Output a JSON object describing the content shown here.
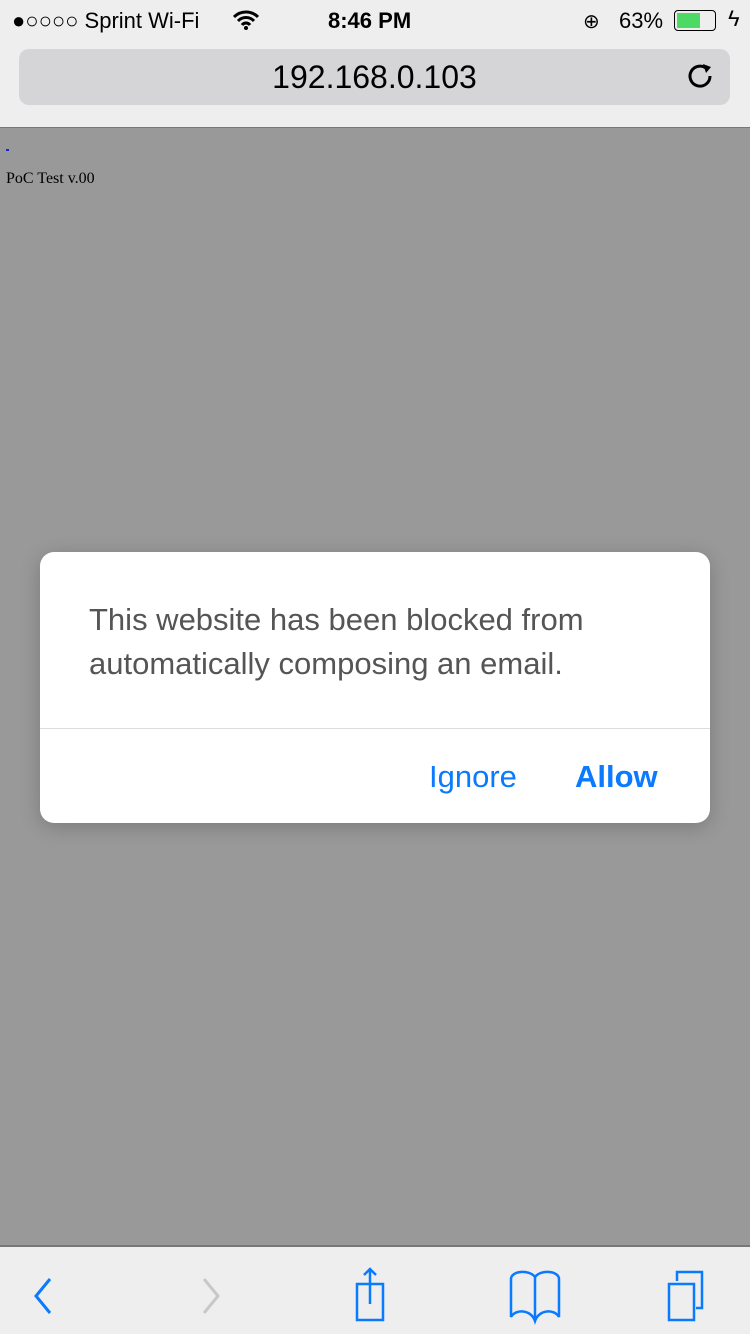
{
  "status_bar": {
    "carrier": "●○○○○ Sprint Wi-Fi",
    "time": "8:46 PM",
    "battery": "63%",
    "battery_level": 0.63
  },
  "address_bar": {
    "url": "192.168.0.103"
  },
  "page": {
    "text": "PoC Test v.00"
  },
  "dialog": {
    "message": "This website has been blocked from automatically composing an email.",
    "ignore_label": "Ignore",
    "allow_label": "Allow"
  },
  "colors": {
    "accent": "#0a7aff",
    "battery": "#4cd964"
  }
}
